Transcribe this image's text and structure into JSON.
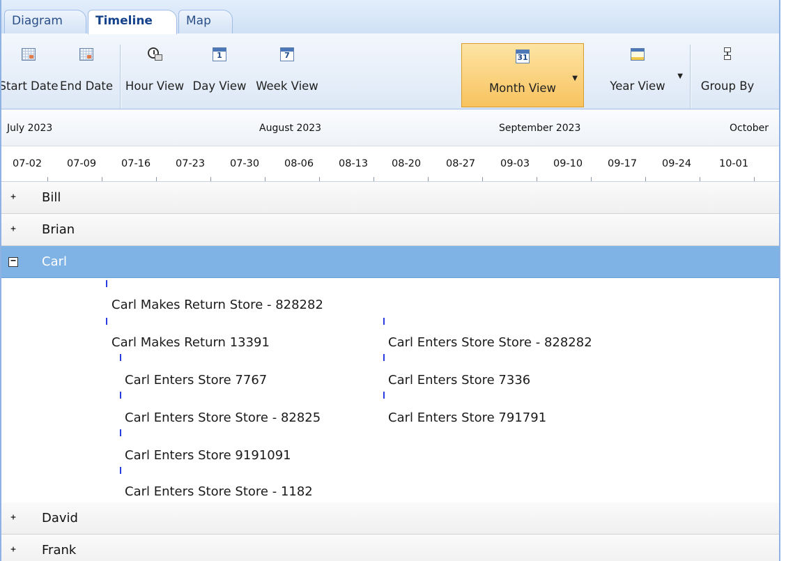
{
  "tabs": [
    {
      "label": "Diagram",
      "active": false
    },
    {
      "label": "Timeline",
      "active": true
    },
    {
      "label": "Map",
      "active": false
    }
  ],
  "toolbar": {
    "start_date": "Start Date",
    "end_date": "End Date",
    "hour_view": "Hour View",
    "day_view": "Day View",
    "day_icon_num": "1",
    "week_view": "Week View",
    "week_icon_num": "7",
    "month_view": "Month View",
    "month_icon_num": "31",
    "year_view": "Year View",
    "group_by": "Group By",
    "selected": "Month View"
  },
  "timeline": {
    "months": [
      "July 2023",
      "August 2023",
      "September 2023",
      "October"
    ],
    "weeks": [
      "07-02",
      "07-09",
      "07-16",
      "07-23",
      "07-30",
      "08-06",
      "08-13",
      "08-20",
      "08-27",
      "09-03",
      "09-10",
      "09-17",
      "09-24",
      "10-01"
    ]
  },
  "groups": [
    {
      "name": "Bill",
      "expanded": false,
      "expand_glyph": "+"
    },
    {
      "name": "Brian",
      "expanded": false,
      "expand_glyph": "+"
    },
    {
      "name": "Carl",
      "expanded": true,
      "expand_glyph": "−"
    },
    {
      "name": "David",
      "expanded": false,
      "expand_glyph": "+"
    },
    {
      "name": "Frank",
      "expanded": false,
      "expand_glyph": "+"
    }
  ],
  "carl_events": [
    "Carl  Makes Return Store - 828282",
    "Carl  Makes Return 13391",
    "Carl  Enters Store 7767",
    "Carl  Enters Store Store - 82825",
    "Carl  Enters Store 9191091",
    "Carl  Enters Store Store - 1182",
    "Carl  Enters Store Store - 828282",
    "Carl  Enters Store 7336",
    "Carl  Enters Store 791791"
  ],
  "colors": {
    "selected_row": "#7fb2e5",
    "selected_button": "#f8c35f",
    "event_marker": "#2a3de0",
    "tab_text": "#15428b"
  }
}
